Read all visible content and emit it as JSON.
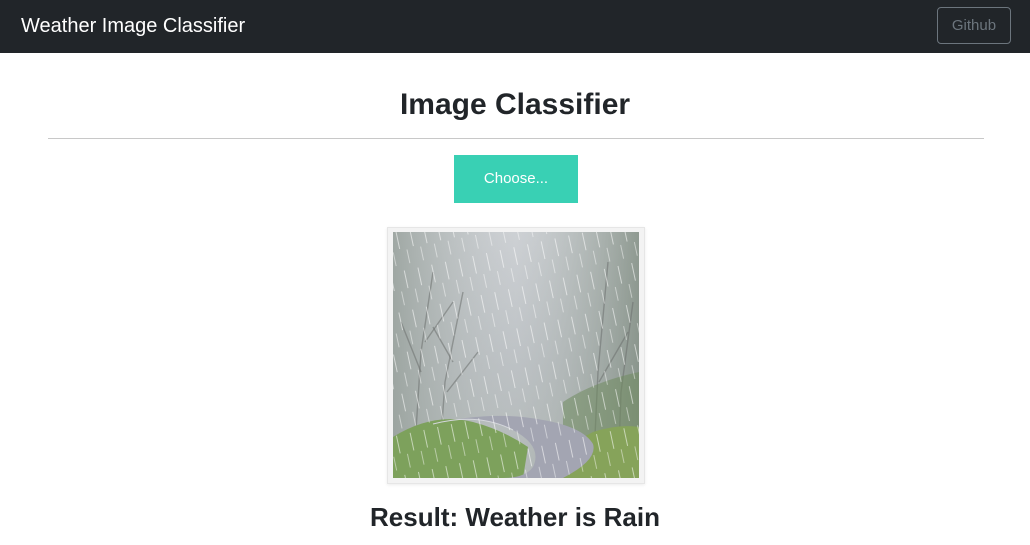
{
  "navbar": {
    "brand": "Weather Image Classifier",
    "github_label": "Github"
  },
  "main": {
    "title": "Image Classifier",
    "choose_label": "Choose...",
    "preview_alt": "rainy road through forest",
    "result_text": "Result: Weather is Rain"
  },
  "colors": {
    "navbar_bg": "#212529",
    "accent": "#39d0b4",
    "text": "#212529",
    "muted": "#6c757d"
  }
}
